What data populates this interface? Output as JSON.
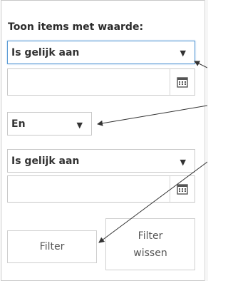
{
  "filter_panel": {
    "title": "Toon items met waarde:",
    "condition1": {
      "operator": "Is gelijk aan"
    },
    "value1": {
      "value": ""
    },
    "logic": {
      "selected": "En"
    },
    "condition2": {
      "operator": "Is gelijk aan"
    },
    "value2": {
      "value": ""
    },
    "filter_button": "Filter",
    "clear_button_line1": "Filter",
    "clear_button_line2": "wissen"
  },
  "icons": {
    "calendar": "calendar-icon",
    "dropdown": "chevron-down-icon"
  },
  "colors": {
    "focus_border": "#5b9bd5",
    "arrow": "#333333"
  }
}
